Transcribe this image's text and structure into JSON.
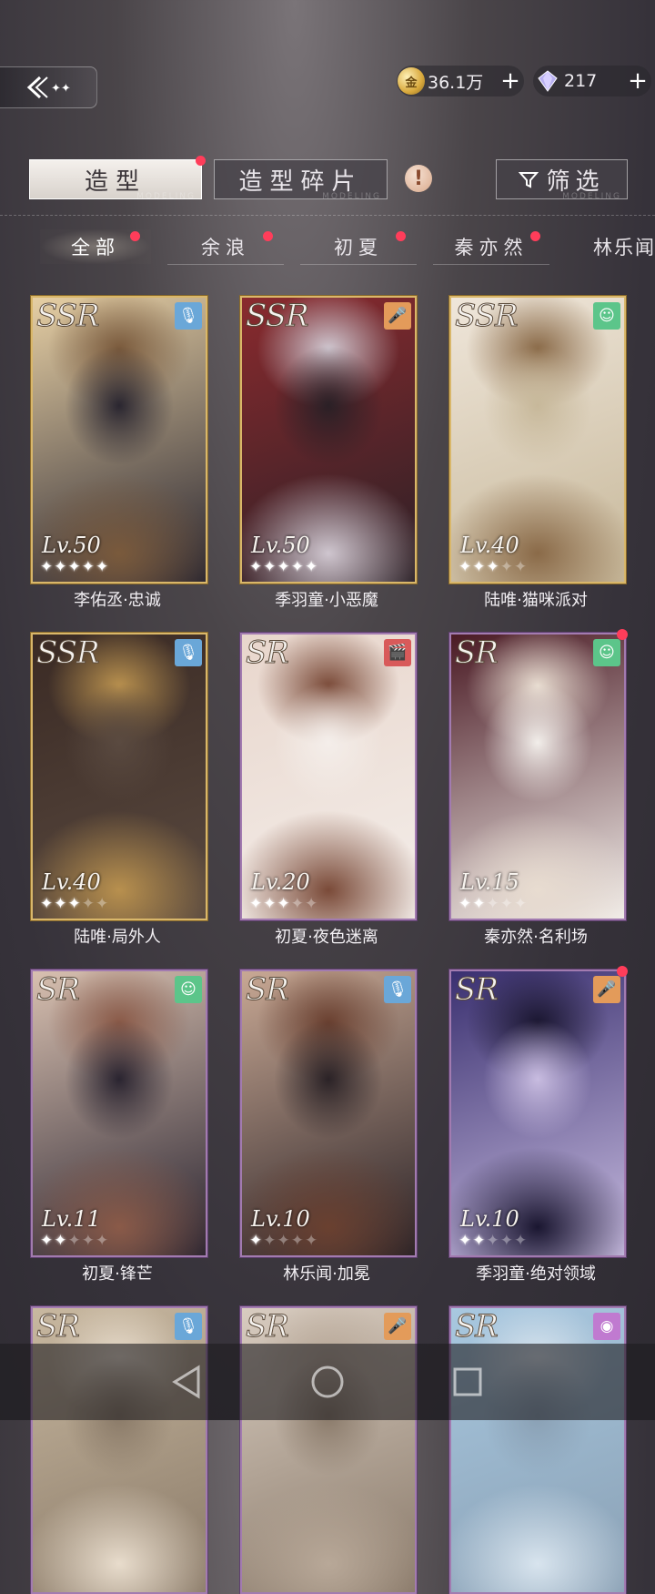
{
  "currency": {
    "gold_icon_text": "金",
    "gold_value": "36.1万",
    "gem_value": "217",
    "plus_label": "+"
  },
  "tabs": {
    "model": "造型",
    "model_sub": "MODELING",
    "fragment": "造型碎片",
    "fragment_sub": "MODELING",
    "warn_glyph": "!",
    "filter": "筛选",
    "filter_sub": "MODELING"
  },
  "characters": [
    {
      "label": "全部",
      "dot": true
    },
    {
      "label": "余浪",
      "dot": true
    },
    {
      "label": "初夏",
      "dot": true
    },
    {
      "label": "秦亦然",
      "dot": true
    },
    {
      "label": "林乐闻",
      "dot": false
    }
  ],
  "cards": [
    {
      "rarity": "SSR",
      "level": "Lv.50",
      "stars": 5,
      "name": "李佑丞·忠诚",
      "icon": "mic-icon",
      "icon_color": "#6aa7d8",
      "dot": false,
      "palette": [
        "#e6cfa4",
        "#7a5a3c",
        "#2a2630"
      ]
    },
    {
      "rarity": "SSR",
      "level": "Lv.50",
      "stars": 5,
      "name": "季羽童·小恶魔",
      "icon": "microphone-handheld-icon",
      "icon_color": "#e39b5a",
      "dot": false,
      "palette": [
        "#8a2a2e",
        "#cfc6cf",
        "#2a2026"
      ]
    },
    {
      "rarity": "SSR",
      "level": "Lv.40",
      "stars": 3,
      "name": "陆唯·猫咪派对",
      "icon": "smile-icon",
      "icon_color": "#5cc58a",
      "dot": false,
      "palette": [
        "#efe6da",
        "#8a6a48",
        "#c7b89a"
      ]
    },
    {
      "rarity": "SSR",
      "level": "Lv.40",
      "stars": 3,
      "name": "陆唯·局外人",
      "icon": "mic-icon",
      "icon_color": "#6aa7d8",
      "dot": false,
      "palette": [
        "#3a2a24",
        "#b8904e",
        "#5a4a40"
      ]
    },
    {
      "rarity": "SR",
      "level": "Lv.20",
      "stars": 3,
      "name": "初夏·夜色迷离",
      "icon": "clapperboard-icon",
      "icon_color": "#d85a5a",
      "dot": false,
      "palette": [
        "#e8d6cc",
        "#7a4a38",
        "#f4eeea"
      ]
    },
    {
      "rarity": "SR",
      "level": "Lv.15",
      "stars": 2,
      "name": "秦亦然·名利场",
      "icon": "smile-icon",
      "icon_color": "#5cc58a",
      "dot": true,
      "palette": [
        "#4a1a24",
        "#e8dcd0",
        "#f2eeea"
      ]
    },
    {
      "rarity": "SR",
      "level": "Lv.11",
      "stars": 2,
      "name": "初夏·锋芒",
      "icon": "smile-icon",
      "icon_color": "#5cc58a",
      "dot": false,
      "palette": [
        "#d8c0b0",
        "#8a5a48",
        "#2a2430"
      ]
    },
    {
      "rarity": "SR",
      "level": "Lv.10",
      "stars": 1,
      "name": "林乐闻·加冕",
      "icon": "mic-icon",
      "icon_color": "#6aa7d8",
      "dot": false,
      "palette": [
        "#c8a894",
        "#6a4030",
        "#2a2226"
      ]
    },
    {
      "rarity": "SR",
      "level": "Lv.10",
      "stars": 2,
      "name": "季羽童·绝对领域",
      "icon": "microphone-handheld-icon",
      "icon_color": "#e39b5a",
      "dot": true,
      "palette": [
        "#3a3070",
        "#1a1630",
        "#c8bce0"
      ]
    },
    {
      "rarity": "SR",
      "level": "",
      "stars": 0,
      "name": "",
      "icon": "mic-icon",
      "icon_color": "#6aa7d8",
      "dot": false,
      "palette": [
        "#c8b8a0",
        "#e8dccc",
        "#8a7a68"
      ]
    },
    {
      "rarity": "SR",
      "level": "",
      "stars": 0,
      "name": "",
      "icon": "microphone-handheld-icon",
      "icon_color": "#e39b5a",
      "dot": false,
      "palette": [
        "#d8ccc0",
        "#b8a898",
        "#8a7a6a"
      ]
    },
    {
      "rarity": "SR",
      "level": "",
      "stars": 0,
      "name": "",
      "icon": "camera-icon",
      "icon_color": "#c07ad0",
      "dot": false,
      "palette": [
        "#a8c8e0",
        "#d8e4ee",
        "#8aa0b4"
      ]
    }
  ]
}
